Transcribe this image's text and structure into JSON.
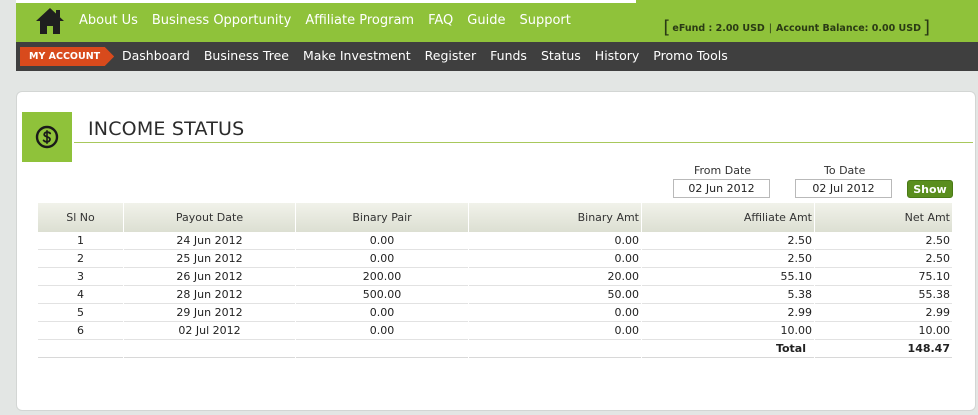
{
  "top_nav": {
    "items": [
      "About Us",
      "Business Opportunity",
      "Affiliate Program",
      "FAQ",
      "Guide",
      "Support"
    ]
  },
  "balance": {
    "efund": "eFund : 2.00 USD",
    "separator": "|",
    "account_balance": "Account Balance: 0.00 USD"
  },
  "account_nav": {
    "badge": "MY ACCOUNT",
    "items": [
      "Dashboard",
      "Business Tree",
      "Make Investment",
      "Register",
      "Funds",
      "Status",
      "History",
      "Promo Tools"
    ]
  },
  "page": {
    "title": "INCOME STATUS"
  },
  "filter": {
    "from_label": "From Date",
    "from_value": "02 Jun 2012",
    "to_label": "To Date",
    "to_value": "02 Jul 2012",
    "show_label": "Show"
  },
  "table": {
    "headers": [
      "Sl No",
      "Payout Date",
      "Binary Pair",
      "Binary Amt",
      "Affiliate Amt",
      "Net Amt"
    ],
    "rows": [
      [
        "1",
        "24 Jun 2012",
        "0.00",
        "0.00",
        "2.50",
        "2.50"
      ],
      [
        "2",
        "25 Jun 2012",
        "0.00",
        "0.00",
        "2.50",
        "2.50"
      ],
      [
        "3",
        "26 Jun 2012",
        "200.00",
        "20.00",
        "55.10",
        "75.10"
      ],
      [
        "4",
        "28 Jun 2012",
        "500.00",
        "50.00",
        "5.38",
        "55.38"
      ],
      [
        "5",
        "29 Jun 2012",
        "0.00",
        "0.00",
        "2.99",
        "2.99"
      ],
      [
        "6",
        "02 Jul 2012",
        "0.00",
        "0.00",
        "10.00",
        "10.00"
      ]
    ],
    "total_label": "Total",
    "total_value": "148.47"
  },
  "colors": {
    "brand_green": "#8fc23a",
    "nav_dark": "#3f3f3f",
    "badge_orange": "#d84a1c",
    "button_green": "#5a8e1e"
  },
  "icons": {
    "home": "home-icon",
    "dollar": "dollar-icon"
  }
}
